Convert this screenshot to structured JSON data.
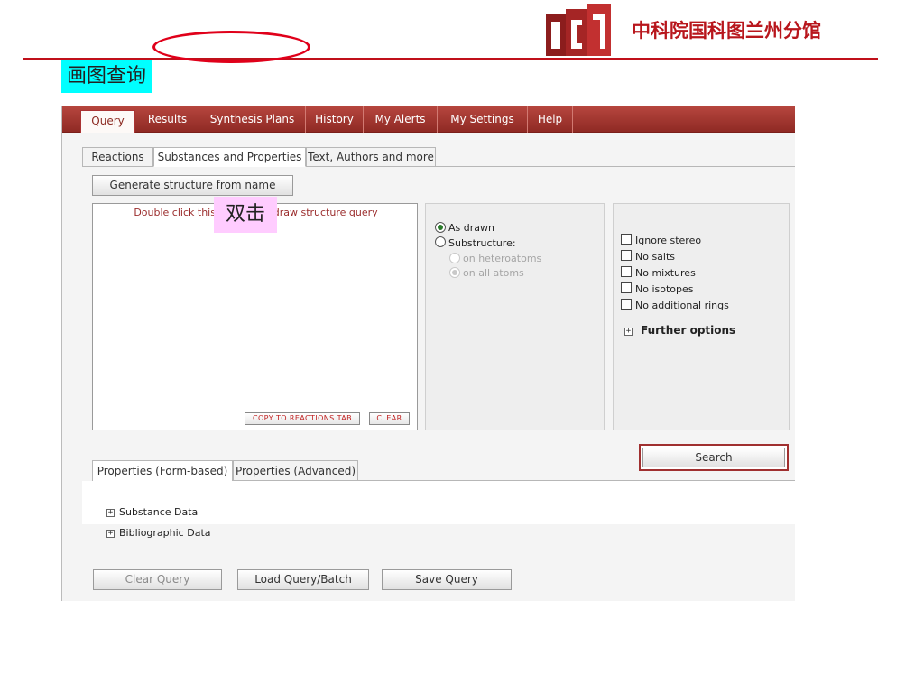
{
  "header": {
    "org_name": "中科院国科图兰州分馆",
    "slide_title": "画图查询",
    "colors": {
      "brand_red": "#b8161c",
      "title_bg": "#00ffff",
      "nav_bg": "#a23a33"
    }
  },
  "nav": {
    "items": [
      "Query",
      "Results",
      "Synthesis Plans",
      "History",
      "My Alerts",
      "My Settings",
      "Help"
    ],
    "active": "Query"
  },
  "query_tabs": {
    "items": [
      "Reactions",
      "Substances and Properties",
      "Text, Authors and more"
    ],
    "active": "Substances and Properties"
  },
  "structure": {
    "generate_button": "Generate structure from name",
    "draw_hint": "Double click this frame and draw structure query",
    "double_click_label": "双击",
    "copy_button": "COPY TO REACTIONS TAB",
    "clear_button": "CLEAR"
  },
  "search_mode": {
    "as_drawn": "As drawn",
    "substructure": "Substructure:",
    "on_heteroatoms": "on heteroatoms",
    "on_all_atoms": "on all atoms",
    "selected": "As drawn"
  },
  "options": {
    "checkboxes": [
      "Ignore stereo",
      "No salts",
      "No mixtures",
      "No isotopes",
      "No additional rings"
    ],
    "further_options": "Further options"
  },
  "search_button": "Search",
  "property_tabs": {
    "items": [
      "Properties (Form-based)",
      "Properties (Advanced)"
    ],
    "active": "Properties (Form-based)",
    "sections": [
      "Substance Data",
      "Bibliographic Data"
    ]
  },
  "bottom_buttons": {
    "clear_query": "Clear Query",
    "load_query": "Load Query/Batch",
    "save_query": "Save Query"
  }
}
